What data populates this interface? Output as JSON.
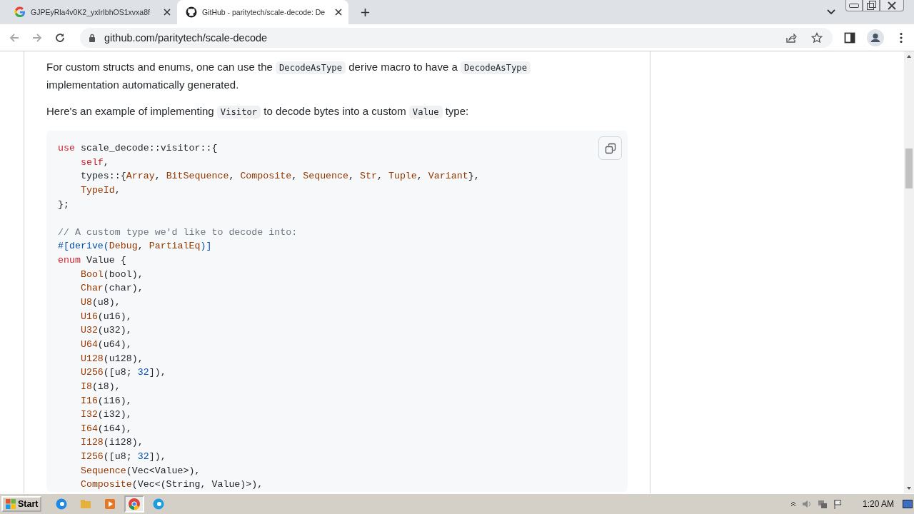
{
  "browser": {
    "tabs": [
      {
        "title": "GJPEyRla4v0K2_yxIrIbhOS1xvxa8f",
        "selected": false
      },
      {
        "title": "GitHub - paritytech/scale-decode: De",
        "selected": true
      }
    ],
    "address": "github.com/paritytech/scale-decode"
  },
  "paragraphs": [
    [
      {
        "kind": "text",
        "text": "For custom structs and enums, one can use the "
      },
      {
        "kind": "code",
        "text": "DecodeAsType"
      },
      {
        "kind": "text",
        "text": " derive macro to have a "
      },
      {
        "kind": "code",
        "text": "DecodeAsType"
      },
      {
        "kind": "text",
        "text": " implementation automatically generated."
      }
    ],
    [
      {
        "kind": "text",
        "text": "Here's an example of implementing "
      },
      {
        "kind": "code",
        "text": "Visitor"
      },
      {
        "kind": "text",
        "text": " to decode bytes into a custom "
      },
      {
        "kind": "code",
        "text": "Value"
      },
      {
        "kind": "text",
        "text": " type:"
      }
    ]
  ],
  "code_sections": [
    {
      "lines": [
        {
          "tokens": [
            {
              "kind": "keyword",
              "text": "use"
            },
            {
              "kind": "plain",
              "text": " scale_decode::visitor::{"
            }
          ]
        },
        {
          "tokens": [
            {
              "kind": "keyword",
              "text": "    self"
            },
            {
              "kind": "plain",
              "text": ","
            }
          ]
        },
        {
          "tokens": [
            {
              "kind": "plain",
              "text": "    types::{"
            },
            {
              "kind": "type",
              "text": "Array"
            },
            {
              "kind": "plain",
              "text": ", "
            },
            {
              "kind": "type",
              "text": "BitSequence"
            },
            {
              "kind": "plain",
              "text": ", "
            },
            {
              "kind": "type",
              "text": "Composite"
            },
            {
              "kind": "plain",
              "text": ", "
            },
            {
              "kind": "type",
              "text": "Sequence"
            },
            {
              "kind": "plain",
              "text": ", "
            },
            {
              "kind": "type",
              "text": "Str"
            },
            {
              "kind": "plain",
              "text": ", "
            },
            {
              "kind": "type",
              "text": "Tuple"
            },
            {
              "kind": "plain",
              "text": ", "
            },
            {
              "kind": "type",
              "text": "Variant"
            },
            {
              "kind": "plain",
              "text": "},"
            }
          ]
        },
        {
          "tokens": [
            {
              "kind": "type",
              "text": "    TypeId"
            },
            {
              "kind": "plain",
              "text": ","
            }
          ]
        },
        {
          "tokens": [
            {
              "kind": "plain",
              "text": "};"
            }
          ]
        }
      ]
    },
    {
      "lines": [
        {
          "tokens": [
            {
              "kind": "comment",
              "text": "// A custom type we'd like to decode into:"
            }
          ]
        },
        {
          "tokens": [
            {
              "kind": "macro",
              "text": "#[derive("
            },
            {
              "kind": "type",
              "text": "Debug"
            },
            {
              "kind": "plain",
              "text": ", "
            },
            {
              "kind": "type",
              "text": "PartialEq"
            },
            {
              "kind": "macro",
              "text": ")]"
            }
          ]
        },
        {
          "tokens": [
            {
              "kind": "keyword",
              "text": "enum"
            },
            {
              "kind": "plain",
              "text": " Value {"
            }
          ]
        },
        {
          "tokens": [
            {
              "kind": "type",
              "text": "    Bool"
            },
            {
              "kind": "plain",
              "text": "(bool),"
            }
          ]
        },
        {
          "tokens": [
            {
              "kind": "type",
              "text": "    Char"
            },
            {
              "kind": "plain",
              "text": "(char),"
            }
          ]
        },
        {
          "tokens": [
            {
              "kind": "type",
              "text": "    U8"
            },
            {
              "kind": "plain",
              "text": "(u8),"
            }
          ]
        },
        {
          "tokens": [
            {
              "kind": "type",
              "text": "    U16"
            },
            {
              "kind": "plain",
              "text": "(u16),"
            }
          ]
        },
        {
          "tokens": [
            {
              "kind": "type",
              "text": "    U32"
            },
            {
              "kind": "plain",
              "text": "(u32),"
            }
          ]
        },
        {
          "tokens": [
            {
              "kind": "type",
              "text": "    U64"
            },
            {
              "kind": "plain",
              "text": "(u64),"
            }
          ]
        },
        {
          "tokens": [
            {
              "kind": "type",
              "text": "    U128"
            },
            {
              "kind": "plain",
              "text": "(u128),"
            }
          ]
        },
        {
          "tokens": [
            {
              "kind": "type",
              "text": "    U256"
            },
            {
              "kind": "plain",
              "text": "([u8; "
            },
            {
              "kind": "number",
              "text": "32"
            },
            {
              "kind": "plain",
              "text": "]),"
            }
          ]
        },
        {
          "tokens": [
            {
              "kind": "type",
              "text": "    I8"
            },
            {
              "kind": "plain",
              "text": "(i8),"
            }
          ]
        },
        {
          "tokens": [
            {
              "kind": "type",
              "text": "    I16"
            },
            {
              "kind": "plain",
              "text": "(i16),"
            }
          ]
        },
        {
          "tokens": [
            {
              "kind": "type",
              "text": "    I32"
            },
            {
              "kind": "plain",
              "text": "(i32),"
            }
          ]
        },
        {
          "tokens": [
            {
              "kind": "type",
              "text": "    I64"
            },
            {
              "kind": "plain",
              "text": "(i64),"
            }
          ]
        },
        {
          "tokens": [
            {
              "kind": "type",
              "text": "    I128"
            },
            {
              "kind": "plain",
              "text": "(i128),"
            }
          ]
        },
        {
          "tokens": [
            {
              "kind": "type",
              "text": "    I256"
            },
            {
              "kind": "plain",
              "text": "([u8; "
            },
            {
              "kind": "number",
              "text": "32"
            },
            {
              "kind": "plain",
              "text": "]),"
            }
          ]
        },
        {
          "tokens": [
            {
              "kind": "type",
              "text": "    Sequence"
            },
            {
              "kind": "plain",
              "text": "(Vec<Value>),"
            }
          ]
        },
        {
          "tokens": [
            {
              "kind": "type",
              "text": "    Composite"
            },
            {
              "kind": "plain",
              "text": "(Vec<(String, Value)>),"
            }
          ]
        }
      ]
    }
  ],
  "taskbar": {
    "start": "Start",
    "apps": [
      {
        "selected": false
      },
      {
        "selected": false
      },
      {
        "selected": false
      },
      {
        "selected": true
      },
      {
        "selected": false
      }
    ],
    "clock": "1:20 AM"
  }
}
